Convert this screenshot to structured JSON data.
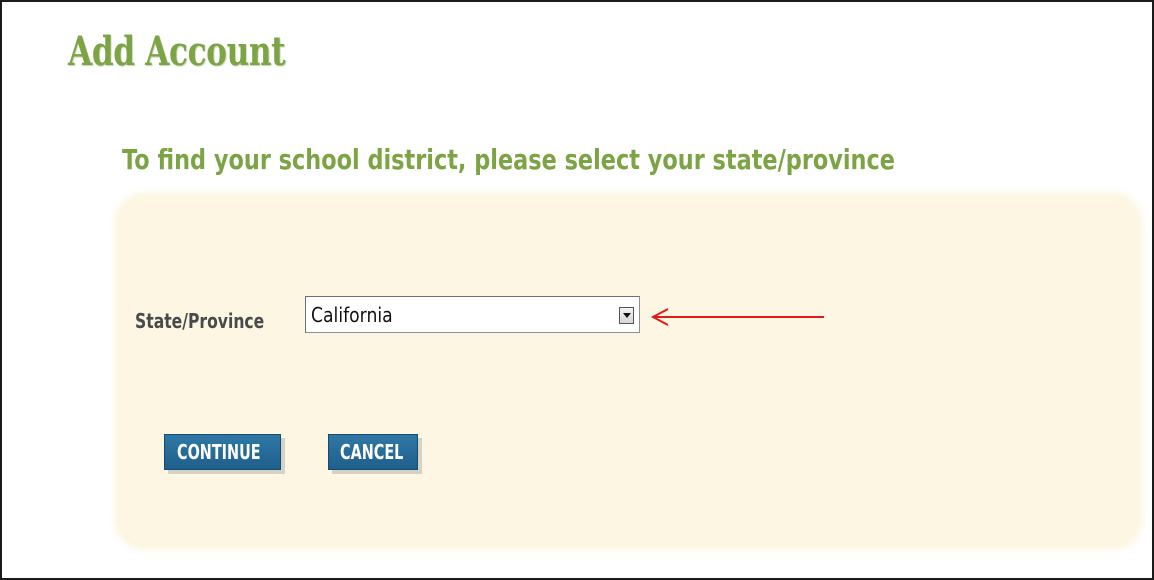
{
  "page": {
    "title": "Add Account",
    "instructions": "To find your school district, please select your state/province"
  },
  "form": {
    "state_label": "State/Province",
    "state_selected": "California",
    "continue_label": "CONTINUE",
    "cancel_label": "CANCEL"
  },
  "icons": {
    "dropdown": "chevron-down-icon",
    "annotation": "red-arrow-left-icon"
  },
  "colors": {
    "title_green": "#7da444",
    "panel_background": "#fdf6e2",
    "button_blue": "#2369a1",
    "annotation_red": "#e01b1b"
  }
}
